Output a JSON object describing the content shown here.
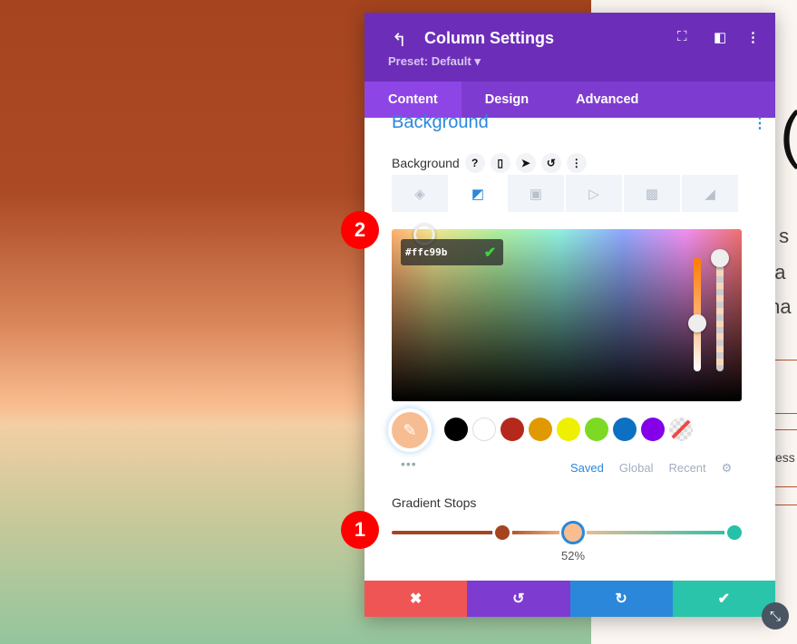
{
  "page": {
    "big_char": "(",
    "text_lines": [
      "s s",
      "t a",
      "ma",
      "ess"
    ]
  },
  "panel": {
    "title": "Column Settings",
    "preset": "Preset: Default ▾",
    "tabs": [
      "Content",
      "Design",
      "Advanced"
    ],
    "section": "Background",
    "field_label": "Background",
    "background_types": [
      "color",
      "gradient",
      "image",
      "video",
      "pattern",
      "mask"
    ],
    "color": {
      "hex": "#ffc99b",
      "current": "#f6bd93",
      "swatches": [
        "#000000",
        "#ffffff",
        "#b5291c",
        "#e09900",
        "#edf000",
        "#7cda24",
        "#0c71c3",
        "#8300e9",
        "transparent"
      ],
      "categories": [
        "Saved",
        "Global",
        "Recent"
      ],
      "active_category": "Saved"
    },
    "gradient": {
      "label": "Gradient Stops",
      "stops": [
        {
          "position": 0,
          "color": "#a5441f"
        },
        {
          "position": 32,
          "color": "#a5441f"
        },
        {
          "position": 52,
          "color": "#f9bd8f"
        },
        {
          "position": 100,
          "color": "#27c0a8"
        }
      ],
      "selected_label": "52%"
    },
    "footer_colors": [
      "#ef5555",
      "#7e3bd0",
      "#2b87da",
      "#29c4a9"
    ]
  },
  "annotations": [
    "1",
    "2"
  ]
}
